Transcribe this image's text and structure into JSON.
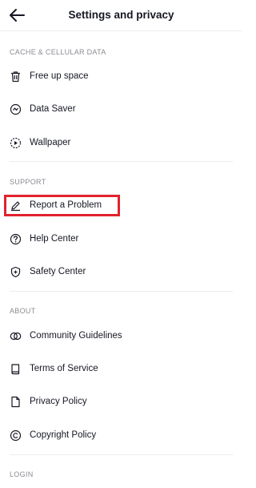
{
  "header": {
    "title": "Settings and privacy",
    "back_icon": "arrow-left-icon"
  },
  "sections": {
    "cache": {
      "title": "CACHE & CELLULAR DATA",
      "items": [
        {
          "label": "Free up space",
          "icon": "trash-icon"
        },
        {
          "label": "Data Saver",
          "icon": "data-saver-icon"
        },
        {
          "label": "Wallpaper",
          "icon": "wallpaper-icon"
        }
      ]
    },
    "support": {
      "title": "SUPPORT",
      "items": [
        {
          "label": "Report a Problem",
          "icon": "pencil-icon"
        },
        {
          "label": "Help Center",
          "icon": "question-circle-icon"
        },
        {
          "label": "Safety Center",
          "icon": "shield-plus-icon"
        }
      ]
    },
    "about": {
      "title": "ABOUT",
      "items": [
        {
          "label": "Community Guidelines",
          "icon": "overlapping-circles-icon"
        },
        {
          "label": "Terms of Service",
          "icon": "book-icon"
        },
        {
          "label": "Privacy Policy",
          "icon": "document-icon"
        },
        {
          "label": "Copyright Policy",
          "icon": "copyright-icon"
        }
      ]
    },
    "login": {
      "title": "LOGIN"
    }
  },
  "colors": {
    "highlight": "#e2222e",
    "text": "#161823",
    "section_title": "#8a8b91",
    "divider": "#ececec"
  }
}
